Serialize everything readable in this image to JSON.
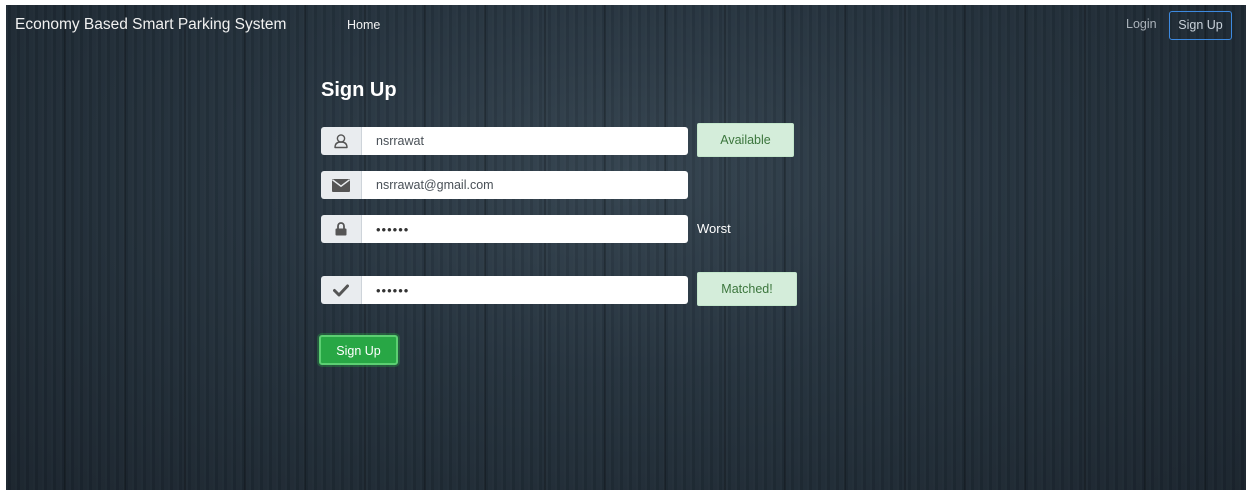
{
  "navbar": {
    "brand": "Economy Based Smart Parking System",
    "home_label": "Home",
    "login_label": "Login",
    "signup_label": "Sign Up"
  },
  "form": {
    "title": "Sign Up",
    "username": {
      "value": "nsrrawat",
      "icon": "user-icon",
      "status": "Available"
    },
    "email": {
      "value": "nsrrawat@gmail.com",
      "icon": "envelope-icon"
    },
    "password": {
      "value": "••••••",
      "icon": "lock-icon",
      "strength": "Worst"
    },
    "confirm_password": {
      "value": "••••••",
      "icon": "check-icon",
      "status": "Matched!"
    },
    "submit_label": "Sign Up"
  },
  "colors": {
    "background": "#25323d",
    "success_badge": "#d4edda",
    "submit_button": "#28a745",
    "navbar_outline": "#3d8ae0"
  }
}
